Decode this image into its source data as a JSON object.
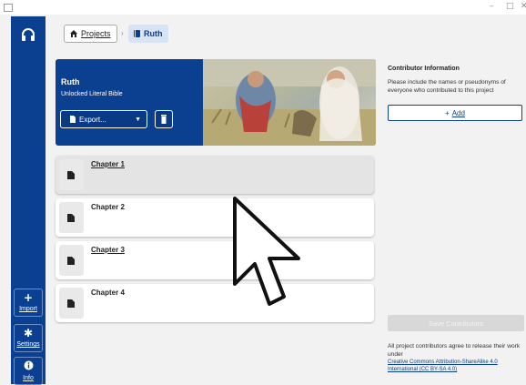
{
  "window": {
    "controls": [
      "–",
      "□",
      "✕"
    ]
  },
  "sidebar": {
    "logo_icon": "headphones-icon",
    "buttons": [
      {
        "id": "import",
        "glyph": "+",
        "label": "Import"
      },
      {
        "id": "settings",
        "glyph": "✱",
        "label": "Settings"
      },
      {
        "id": "info",
        "glyph": "i",
        "label": "Info"
      }
    ]
  },
  "breadcrumb": {
    "home_label": "Projects",
    "separator": "›",
    "current_label": "Ruth"
  },
  "project": {
    "title": "Ruth",
    "subtitle": "Unlocked Literal Bible",
    "export_label": "Export...",
    "banner_image": "ruth-gleaning-illustration"
  },
  "chapters": [
    {
      "label": "Chapter 1",
      "active": true,
      "underlined": true
    },
    {
      "label": "Chapter 2",
      "active": false,
      "underlined": false
    },
    {
      "label": "Chapter 3",
      "active": false,
      "underlined": true
    },
    {
      "label": "Chapter 4",
      "active": false,
      "underlined": false
    }
  ],
  "contributors": {
    "heading": "Contributor Information",
    "description": "Please include the names or pseudonyms of everyone who contributed to this project",
    "add_label": "Add",
    "save_label": "Save Contributors",
    "license_text": "All project contributors agree to release their work under",
    "license_link_1": "Creative Commons Attribution-ShareAlike 4.0",
    "license_link_2": "International (CC BY-SA 4.0)"
  },
  "colors": {
    "brand": "#0b3f8f",
    "background": "#f2f2f2"
  }
}
